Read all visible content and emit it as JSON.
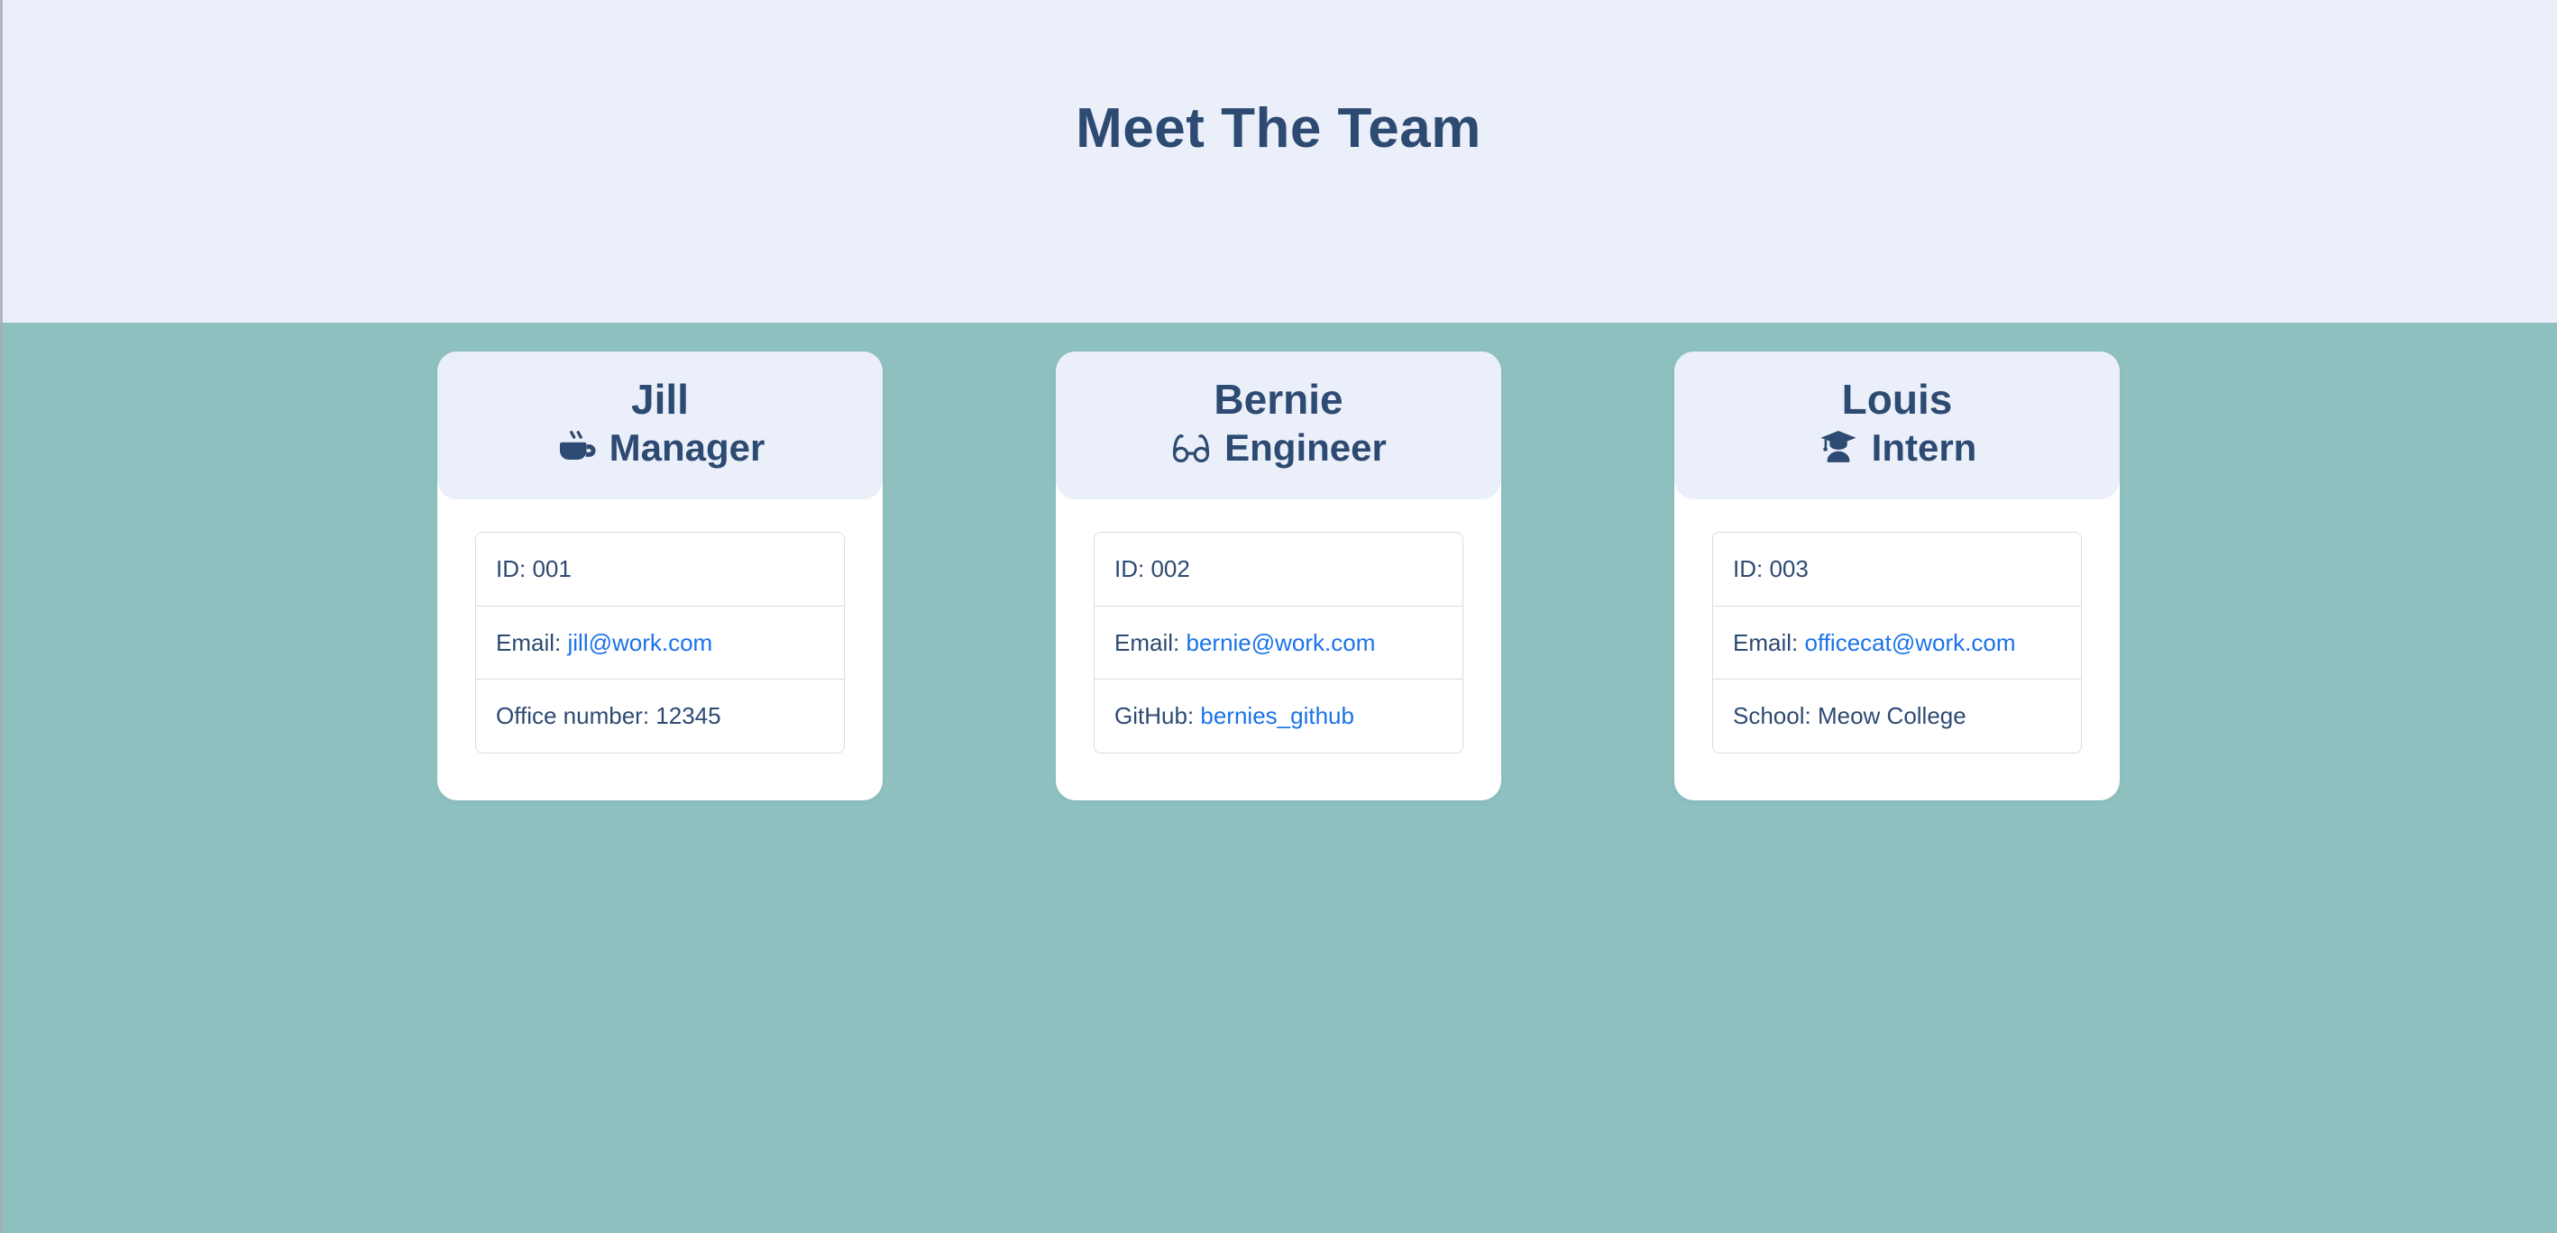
{
  "header": {
    "title": "Meet The Team"
  },
  "theme": {
    "band_background": "#ebeff9",
    "page_background": "#8fc0c0",
    "card_background": "#ffffff",
    "text_navy": "#2d4a72",
    "link_blue": "#1a73e8",
    "table_border": "#d9dde2"
  },
  "members": [
    {
      "name": "Jill",
      "role": "Manager",
      "role_icon": "coffee-cup-icon",
      "rows": [
        {
          "label": "ID:",
          "value": "001",
          "is_link": false
        },
        {
          "label": "Email:",
          "value": "jill@work.com",
          "is_link": true
        },
        {
          "label": "Office number:",
          "value": "12345",
          "is_link": false
        }
      ]
    },
    {
      "name": "Bernie",
      "role": "Engineer",
      "role_icon": "eyeglasses-icon",
      "rows": [
        {
          "label": "ID:",
          "value": "002",
          "is_link": false
        },
        {
          "label": "Email:",
          "value": "bernie@work.com",
          "is_link": true
        },
        {
          "label": "GitHub:",
          "value": "bernies_github",
          "is_link": true
        }
      ]
    },
    {
      "name": "Louis",
      "role": "Intern",
      "role_icon": "graduate-student-icon",
      "rows": [
        {
          "label": "ID:",
          "value": "003",
          "is_link": false
        },
        {
          "label": "Email:",
          "value": "officecat@work.com",
          "is_link": true
        },
        {
          "label": "School:",
          "value": "Meow College",
          "is_link": false
        }
      ]
    }
  ]
}
